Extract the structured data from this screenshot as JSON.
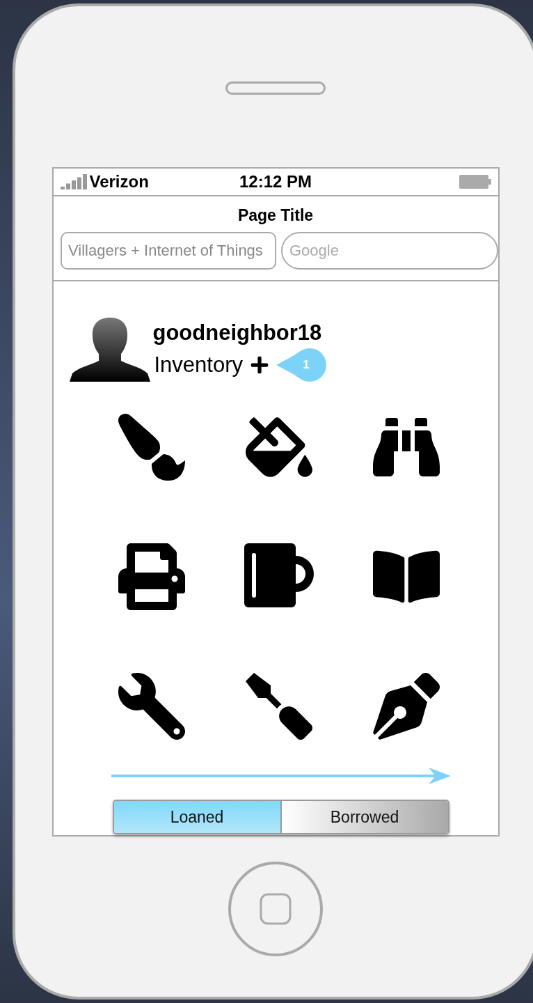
{
  "status_bar": {
    "carrier": "Verizon",
    "time": "12:12 PM"
  },
  "nav": {
    "title": "Page Title",
    "search": {
      "value": "Villagers + Internet of Things"
    },
    "engine": {
      "placeholder": "Google"
    }
  },
  "profile": {
    "username": "goodneighbor18",
    "section": "Inventory",
    "badge": "1"
  },
  "segments": [
    {
      "label": "Loaned",
      "selected": true
    },
    {
      "label": "Borrowed",
      "selected": false
    }
  ]
}
